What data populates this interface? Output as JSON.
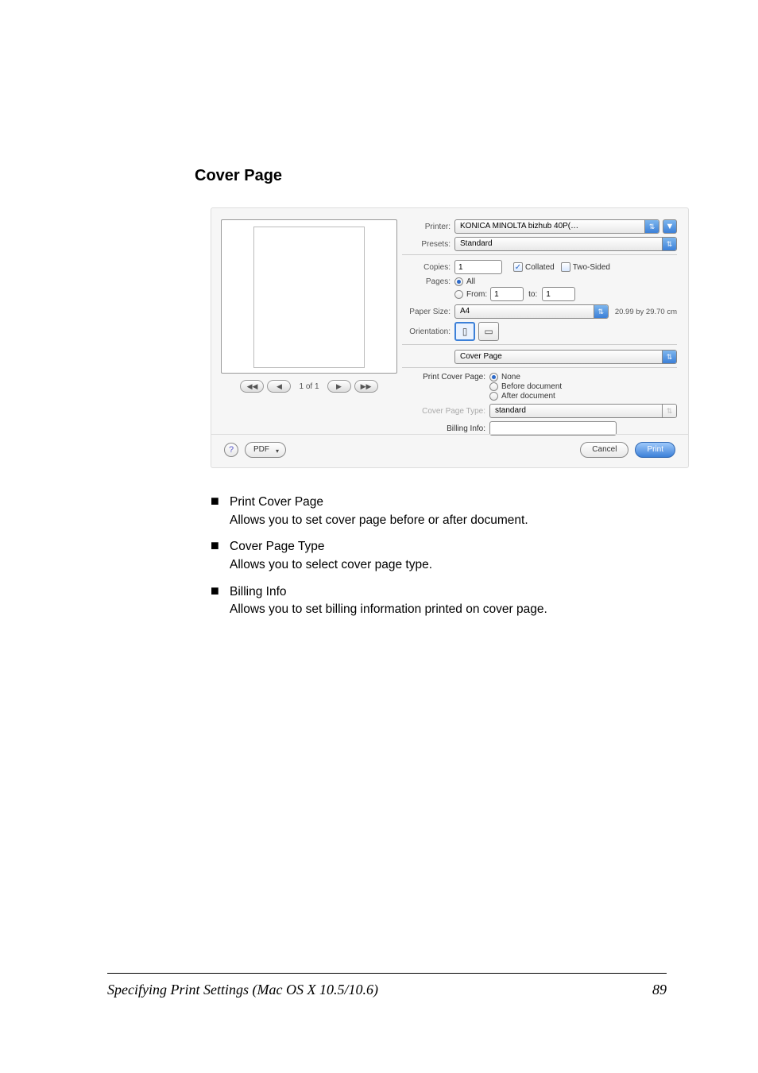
{
  "section_title": "Cover Page",
  "footer": {
    "title": "Specifying Print Settings (Mac OS X 10.5/10.6)",
    "page": "89"
  },
  "dialog": {
    "printer_label": "Printer:",
    "printer_value": "KONICA MINOLTA bizhub 40P(…",
    "presets_label": "Presets:",
    "presets_value": "Standard",
    "copies_label": "Copies:",
    "copies_value": "1",
    "collated_label": "Collated",
    "twosided_label": "Two-Sided",
    "pages_label": "Pages:",
    "pages_all": "All",
    "pages_from_label": "From:",
    "pages_from_value": "1",
    "pages_to_label": "to:",
    "pages_to_value": "1",
    "papersize_label": "Paper Size:",
    "papersize_value": "A4",
    "papersize_dims": "20.99 by 29.70 cm",
    "orientation_label": "Orientation:",
    "section_value": "Cover Page",
    "pcp_label": "Print Cover Page:",
    "pcp_none": "None",
    "pcp_before": "Before document",
    "pcp_after": "After document",
    "cpt_label": "Cover Page Type:",
    "cpt_value": "standard",
    "billing_label": "Billing Info:",
    "page_indicator": "1 of 1",
    "help_label": "?",
    "pdf_label": "PDF",
    "cancel_label": "Cancel",
    "print_label": "Print",
    "icons": {
      "up_down": "⇅",
      "triangle": "▼",
      "portrait_glyph": "⬍",
      "landscape_glyph": "⬌"
    }
  },
  "desc": [
    {
      "title": "Print Cover Page",
      "body": "Allows you to set cover page before or after document."
    },
    {
      "title": "Cover Page Type",
      "body": "Allows you to select cover page type."
    },
    {
      "title": "Billing Info",
      "body": "Allows you to set billing information printed on cover page."
    }
  ]
}
